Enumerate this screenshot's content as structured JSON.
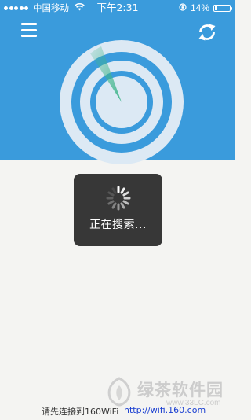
{
  "status_bar": {
    "carrier": "中国移动",
    "time": "下午2:31",
    "battery": "14%",
    "battery_level": 0.14
  },
  "header": {
    "menu_icon": "hamburger-menu-icon",
    "refresh_icon": "refresh-icon"
  },
  "radar": {
    "icon": "radar-scan-icon",
    "colors": {
      "ring": "#dce9f4",
      "inner": "#3a9bdc",
      "sweep": "#3fb58a"
    }
  },
  "toast": {
    "text": "正在搜索..."
  },
  "footer": {
    "text": "请先连接到160WiFi",
    "link": "http://wifi.160.com"
  },
  "watermark": {
    "text": "绿茶软件园",
    "url": "www.33LC.com"
  },
  "colors": {
    "header_bg": "#3a9bdc",
    "body_bg": "#f4f4f2",
    "link": "#1a3fd1"
  }
}
